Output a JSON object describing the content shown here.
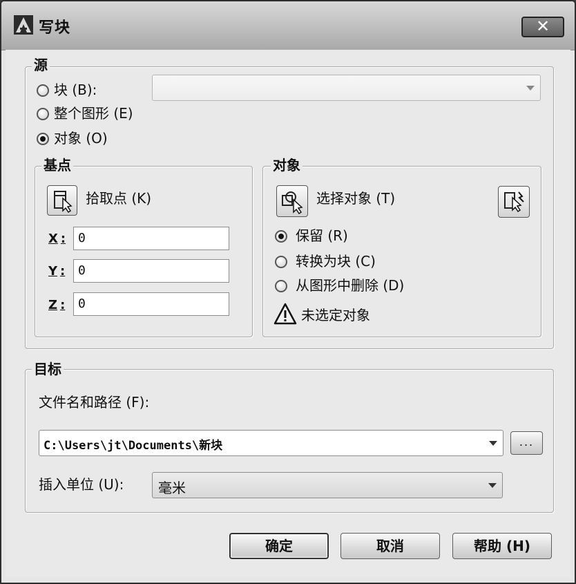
{
  "window": {
    "title": "写块",
    "close_label": "✕",
    "app_icon": "autocad-logo-icon"
  },
  "source": {
    "legend": "源",
    "options": [
      {
        "label": "块 (B):",
        "checked": false
      },
      {
        "label": "整个图形 (E)",
        "checked": false
      },
      {
        "label": "对象 (O)",
        "checked": true
      }
    ],
    "block_select_value": ""
  },
  "base_point": {
    "legend": "基点",
    "pick_label": "拾取点 (K)",
    "pick_icon": "pick-point-icon",
    "x_label": "X",
    "y_label": "Y",
    "z_label": "Z",
    "colon": ":",
    "x_value": "0",
    "y_value": "0",
    "z_value": "0"
  },
  "objects": {
    "legend": "对象",
    "select_label": "选择对象 (T)",
    "select_icon": "select-objects-icon",
    "quick_select_icon": "quick-select-icon",
    "options": [
      {
        "label": "保留 (R)",
        "checked": true
      },
      {
        "label": "转换为块 (C)",
        "checked": false
      },
      {
        "label": "从图形中删除 (D)",
        "checked": false
      }
    ],
    "warning_icon": "warning-icon",
    "warning_text": "未选定对象"
  },
  "destination": {
    "legend": "目标",
    "path_label": "文件名和路径 (F):",
    "path_value": "C:\\Users\\jt\\Documents\\新块",
    "browse_label": "...",
    "units_label": "插入单位 (U):",
    "units_value": "毫米"
  },
  "buttons": {
    "ok": "确定",
    "cancel": "取消",
    "help": "帮助 (H)"
  },
  "colors": {
    "title_bar": "#bcbcbc",
    "dialog_bg": "#e9e9e9",
    "close_button": "#5e5e5e"
  }
}
